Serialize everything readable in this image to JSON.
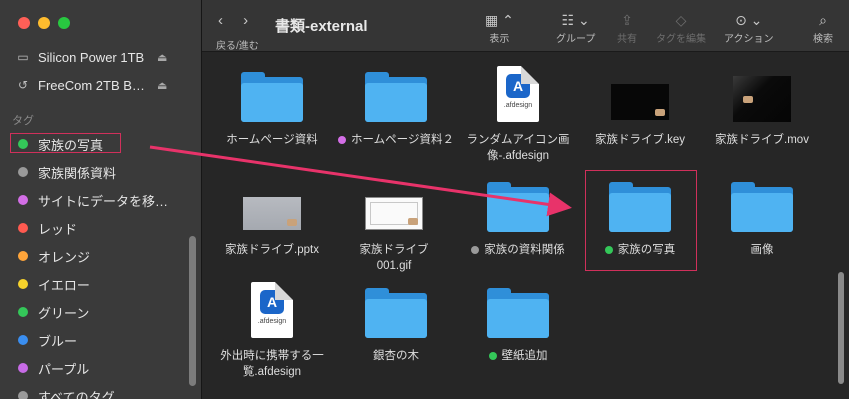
{
  "window": {
    "title": "書類-external"
  },
  "toolbar": {
    "nav_label": "戻る/進む",
    "back_icon": "chevron-left-icon",
    "forward_icon": "chevron-right-icon",
    "view_label": "表示",
    "group_label": "グループ",
    "share_label": "共有",
    "tag_edit_label": "タグを編集",
    "action_label": "アクション",
    "search_label": "検索"
  },
  "sidebar": {
    "devices": [
      {
        "label": "Silicon Power 1TB",
        "icon": "drive-icon"
      },
      {
        "label": "FreeCom 2TB B…",
        "icon": "time-machine-icon"
      }
    ],
    "tags_heading": "タグ",
    "tags": [
      {
        "label": "家族の写真",
        "color": "#34c759"
      },
      {
        "label": "家族関係資料",
        "color": "#9a9a9a"
      },
      {
        "label": "サイトにデータを移…",
        "color": "#d36ee6"
      },
      {
        "label": "レッド",
        "color": "#ff5a50"
      },
      {
        "label": "オレンジ",
        "color": "#ffa53a"
      },
      {
        "label": "イエロー",
        "color": "#f7d32c"
      },
      {
        "label": "グリーン",
        "color": "#34c759"
      },
      {
        "label": "ブルー",
        "color": "#3a8ef0"
      },
      {
        "label": "パープル",
        "color": "#c76be6"
      },
      {
        "label": "すべてのタグ…",
        "color": "#9a9a9a"
      }
    ]
  },
  "files": [
    {
      "name": "ホームページ資料",
      "kind": "folder",
      "tag": null
    },
    {
      "name": "ホームページ資料２",
      "kind": "folder",
      "tag": "#d36ee6"
    },
    {
      "name": "ランダムアイコン画像-.afdesign",
      "kind": "afdesign",
      "tag": null,
      "doc_text": ".afdesign"
    },
    {
      "name": "家族ドライブ.key",
      "kind": "image-black",
      "tag": null
    },
    {
      "name": "家族ドライブ.mov",
      "kind": "image-black2",
      "tag": null
    },
    {
      "name": "家族ドライブ.pptx",
      "kind": "image-gray",
      "tag": null
    },
    {
      "name": "家族ドライブ001.gif",
      "kind": "image-white",
      "tag": null
    },
    {
      "name": "家族の資料関係",
      "kind": "folder",
      "tag": "#9a9a9a"
    },
    {
      "name": "家族の写真",
      "kind": "folder",
      "tag": "#34c759"
    },
    {
      "name": "画像",
      "kind": "folder",
      "tag": null
    },
    {
      "name": "外出時に携帯する一覧.afdesign",
      "kind": "afdesign",
      "tag": null,
      "doc_text": ".afdesign"
    },
    {
      "name": "銀杏の木",
      "kind": "folder",
      "tag": null
    },
    {
      "name": "壁紙追加",
      "kind": "folder",
      "tag": "#34c759"
    }
  ],
  "annotation": {
    "arrow_color": "#e8336a",
    "box_color": "#d0305b"
  }
}
